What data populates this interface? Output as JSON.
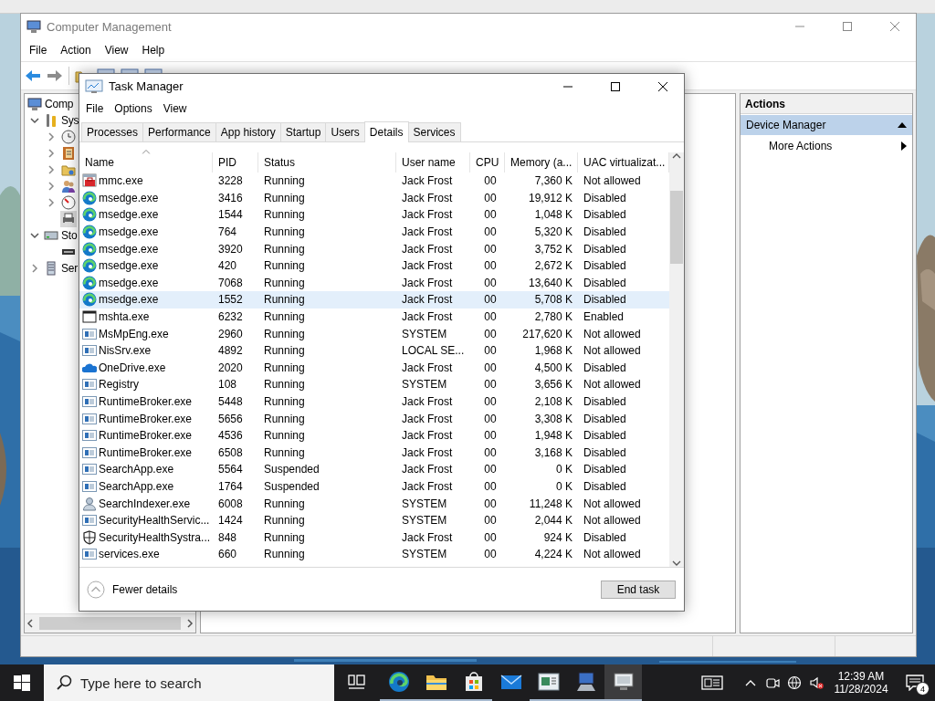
{
  "computer_management": {
    "title": "Computer Management",
    "menu": [
      "File",
      "Action",
      "View",
      "Help"
    ],
    "tree": [
      {
        "kind": "computer",
        "label": "Comp",
        "children": [
          {
            "kind": "tools",
            "label": "Sys",
            "expanded": true,
            "selected": false,
            "children": [
              {
                "kind": "clock",
                "expanded": false,
                "selected": false
              },
              {
                "kind": "log",
                "expanded": false,
                "selected": false
              },
              {
                "kind": "folder",
                "expanded": false,
                "selected": false
              },
              {
                "kind": "users",
                "expanded": false,
                "selected": false
              },
              {
                "kind": "gauge",
                "expanded": false,
                "selected": false
              },
              {
                "kind": "device",
                "selected": true
              }
            ]
          },
          {
            "kind": "storage",
            "label": "Sto",
            "expanded": true,
            "selected": false,
            "children": [
              {
                "kind": "disk",
                "selected": false
              }
            ]
          },
          {
            "kind": "services",
            "label": "Ser",
            "expanded": false,
            "selected": false
          }
        ]
      }
    ],
    "actions": {
      "header": "Actions",
      "items": [
        {
          "kind": "group",
          "label": "Device Manager",
          "selected": true
        },
        {
          "kind": "submenu",
          "label": "More Actions",
          "selected": false
        }
      ]
    }
  },
  "task_manager": {
    "title": "Task Manager",
    "menu": [
      "File",
      "Options",
      "View"
    ],
    "tabs": [
      {
        "label": "Processes",
        "selected": false
      },
      {
        "label": "Performance",
        "selected": false
      },
      {
        "label": "App history",
        "selected": false
      },
      {
        "label": "Startup",
        "selected": false
      },
      {
        "label": "Users",
        "selected": false
      },
      {
        "label": "Details",
        "selected": true
      },
      {
        "label": "Services",
        "selected": false
      }
    ],
    "columns": [
      {
        "label": "Name",
        "sorted": true
      },
      {
        "label": "PID",
        "sorted": false
      },
      {
        "label": "Status",
        "sorted": false
      },
      {
        "label": "User name",
        "sorted": false
      },
      {
        "label": "CPU",
        "sorted": false
      },
      {
        "label": "Memory (a...",
        "sorted": false
      },
      {
        "label": "UAC virtualizat...",
        "sorted": false
      }
    ],
    "rows": [
      {
        "kind": "mmc",
        "name": "mmc.exe",
        "pid": "3228",
        "status": "Running",
        "user": "Jack Frost",
        "cpu": "00",
        "memory": "7,360 K",
        "uac": "Not allowed",
        "selected": false
      },
      {
        "kind": "edge",
        "name": "msedge.exe",
        "pid": "3416",
        "status": "Running",
        "user": "Jack Frost",
        "cpu": "00",
        "memory": "19,912 K",
        "uac": "Disabled",
        "selected": false
      },
      {
        "kind": "edge",
        "name": "msedge.exe",
        "pid": "1544",
        "status": "Running",
        "user": "Jack Frost",
        "cpu": "00",
        "memory": "1,048 K",
        "uac": "Disabled",
        "selected": false
      },
      {
        "kind": "edge",
        "name": "msedge.exe",
        "pid": "764",
        "status": "Running",
        "user": "Jack Frost",
        "cpu": "00",
        "memory": "5,320 K",
        "uac": "Disabled",
        "selected": false
      },
      {
        "kind": "edge",
        "name": "msedge.exe",
        "pid": "3920",
        "status": "Running",
        "user": "Jack Frost",
        "cpu": "00",
        "memory": "3,752 K",
        "uac": "Disabled",
        "selected": false
      },
      {
        "kind": "edge",
        "name": "msedge.exe",
        "pid": "420",
        "status": "Running",
        "user": "Jack Frost",
        "cpu": "00",
        "memory": "2,672 K",
        "uac": "Disabled",
        "selected": false
      },
      {
        "kind": "edge",
        "name": "msedge.exe",
        "pid": "7068",
        "status": "Running",
        "user": "Jack Frost",
        "cpu": "00",
        "memory": "13,640 K",
        "uac": "Disabled",
        "selected": false
      },
      {
        "kind": "edge",
        "name": "msedge.exe",
        "pid": "1552",
        "status": "Running",
        "user": "Jack Frost",
        "cpu": "00",
        "memory": "5,708 K",
        "uac": "Disabled",
        "selected": true
      },
      {
        "kind": "window",
        "name": "mshta.exe",
        "pid": "6232",
        "status": "Running",
        "user": "Jack Frost",
        "cpu": "00",
        "memory": "2,780 K",
        "uac": "Enabled",
        "selected": false
      },
      {
        "kind": "app",
        "name": "MsMpEng.exe",
        "pid": "2960",
        "status": "Running",
        "user": "SYSTEM",
        "cpu": "00",
        "memory": "217,620 K",
        "uac": "Not allowed",
        "selected": false
      },
      {
        "kind": "app",
        "name": "NisSrv.exe",
        "pid": "4892",
        "status": "Running",
        "user": "LOCAL SE...",
        "cpu": "00",
        "memory": "1,968 K",
        "uac": "Not allowed",
        "selected": false
      },
      {
        "kind": "onedrive",
        "name": "OneDrive.exe",
        "pid": "2020",
        "status": "Running",
        "user": "Jack Frost",
        "cpu": "00",
        "memory": "4,500 K",
        "uac": "Disabled",
        "selected": false
      },
      {
        "kind": "app",
        "name": "Registry",
        "pid": "108",
        "status": "Running",
        "user": "SYSTEM",
        "cpu": "00",
        "memory": "3,656 K",
        "uac": "Not allowed",
        "selected": false
      },
      {
        "kind": "app",
        "name": "RuntimeBroker.exe",
        "pid": "5448",
        "status": "Running",
        "user": "Jack Frost",
        "cpu": "00",
        "memory": "2,108 K",
        "uac": "Disabled",
        "selected": false
      },
      {
        "kind": "app",
        "name": "RuntimeBroker.exe",
        "pid": "5656",
        "status": "Running",
        "user": "Jack Frost",
        "cpu": "00",
        "memory": "3,308 K",
        "uac": "Disabled",
        "selected": false
      },
      {
        "kind": "app",
        "name": "RuntimeBroker.exe",
        "pid": "4536",
        "status": "Running",
        "user": "Jack Frost",
        "cpu": "00",
        "memory": "1,948 K",
        "uac": "Disabled",
        "selected": false
      },
      {
        "kind": "app",
        "name": "RuntimeBroker.exe",
        "pid": "6508",
        "status": "Running",
        "user": "Jack Frost",
        "cpu": "00",
        "memory": "3,168 K",
        "uac": "Disabled",
        "selected": false
      },
      {
        "kind": "app",
        "name": "SearchApp.exe",
        "pid": "5564",
        "status": "Suspended",
        "user": "Jack Frost",
        "cpu": "00",
        "memory": "0 K",
        "uac": "Disabled",
        "selected": false
      },
      {
        "kind": "app",
        "name": "SearchApp.exe",
        "pid": "1764",
        "status": "Suspended",
        "user": "Jack Frost",
        "cpu": "00",
        "memory": "0 K",
        "uac": "Disabled",
        "selected": false
      },
      {
        "kind": "user",
        "name": "SearchIndexer.exe",
        "pid": "6008",
        "status": "Running",
        "user": "SYSTEM",
        "cpu": "00",
        "memory": "11,248 K",
        "uac": "Not allowed",
        "selected": false
      },
      {
        "kind": "app",
        "name": "SecurityHealthServic...",
        "pid": "1424",
        "status": "Running",
        "user": "SYSTEM",
        "cpu": "00",
        "memory": "2,044 K",
        "uac": "Not allowed",
        "selected": false
      },
      {
        "kind": "shield",
        "name": "SecurityHealthSystra...",
        "pid": "848",
        "status": "Running",
        "user": "Jack Frost",
        "cpu": "00",
        "memory": "924 K",
        "uac": "Disabled",
        "selected": false
      },
      {
        "kind": "app",
        "name": "services.exe",
        "pid": "660",
        "status": "Running",
        "user": "SYSTEM",
        "cpu": "00",
        "memory": "4,224 K",
        "uac": "Not allowed",
        "selected": false
      }
    ],
    "fewer_details": "Fewer details",
    "end_task": "End task"
  },
  "taskbar": {
    "search": {
      "placeholder": "Type here to search"
    },
    "apps": [
      {
        "kind": "edge",
        "running": true,
        "selected": false
      },
      {
        "kind": "explorer",
        "running": true,
        "selected": false
      },
      {
        "kind": "store",
        "running": true,
        "selected": false
      },
      {
        "kind": "mail",
        "running": false,
        "selected": false
      },
      {
        "kind": "slides",
        "running": true,
        "selected": false
      },
      {
        "kind": "computer",
        "running": true,
        "selected": false
      },
      {
        "kind": "monitor",
        "running": true,
        "selected": true
      }
    ],
    "time": "12:39 AM",
    "date": "11/28/2024",
    "notifications": "4"
  }
}
